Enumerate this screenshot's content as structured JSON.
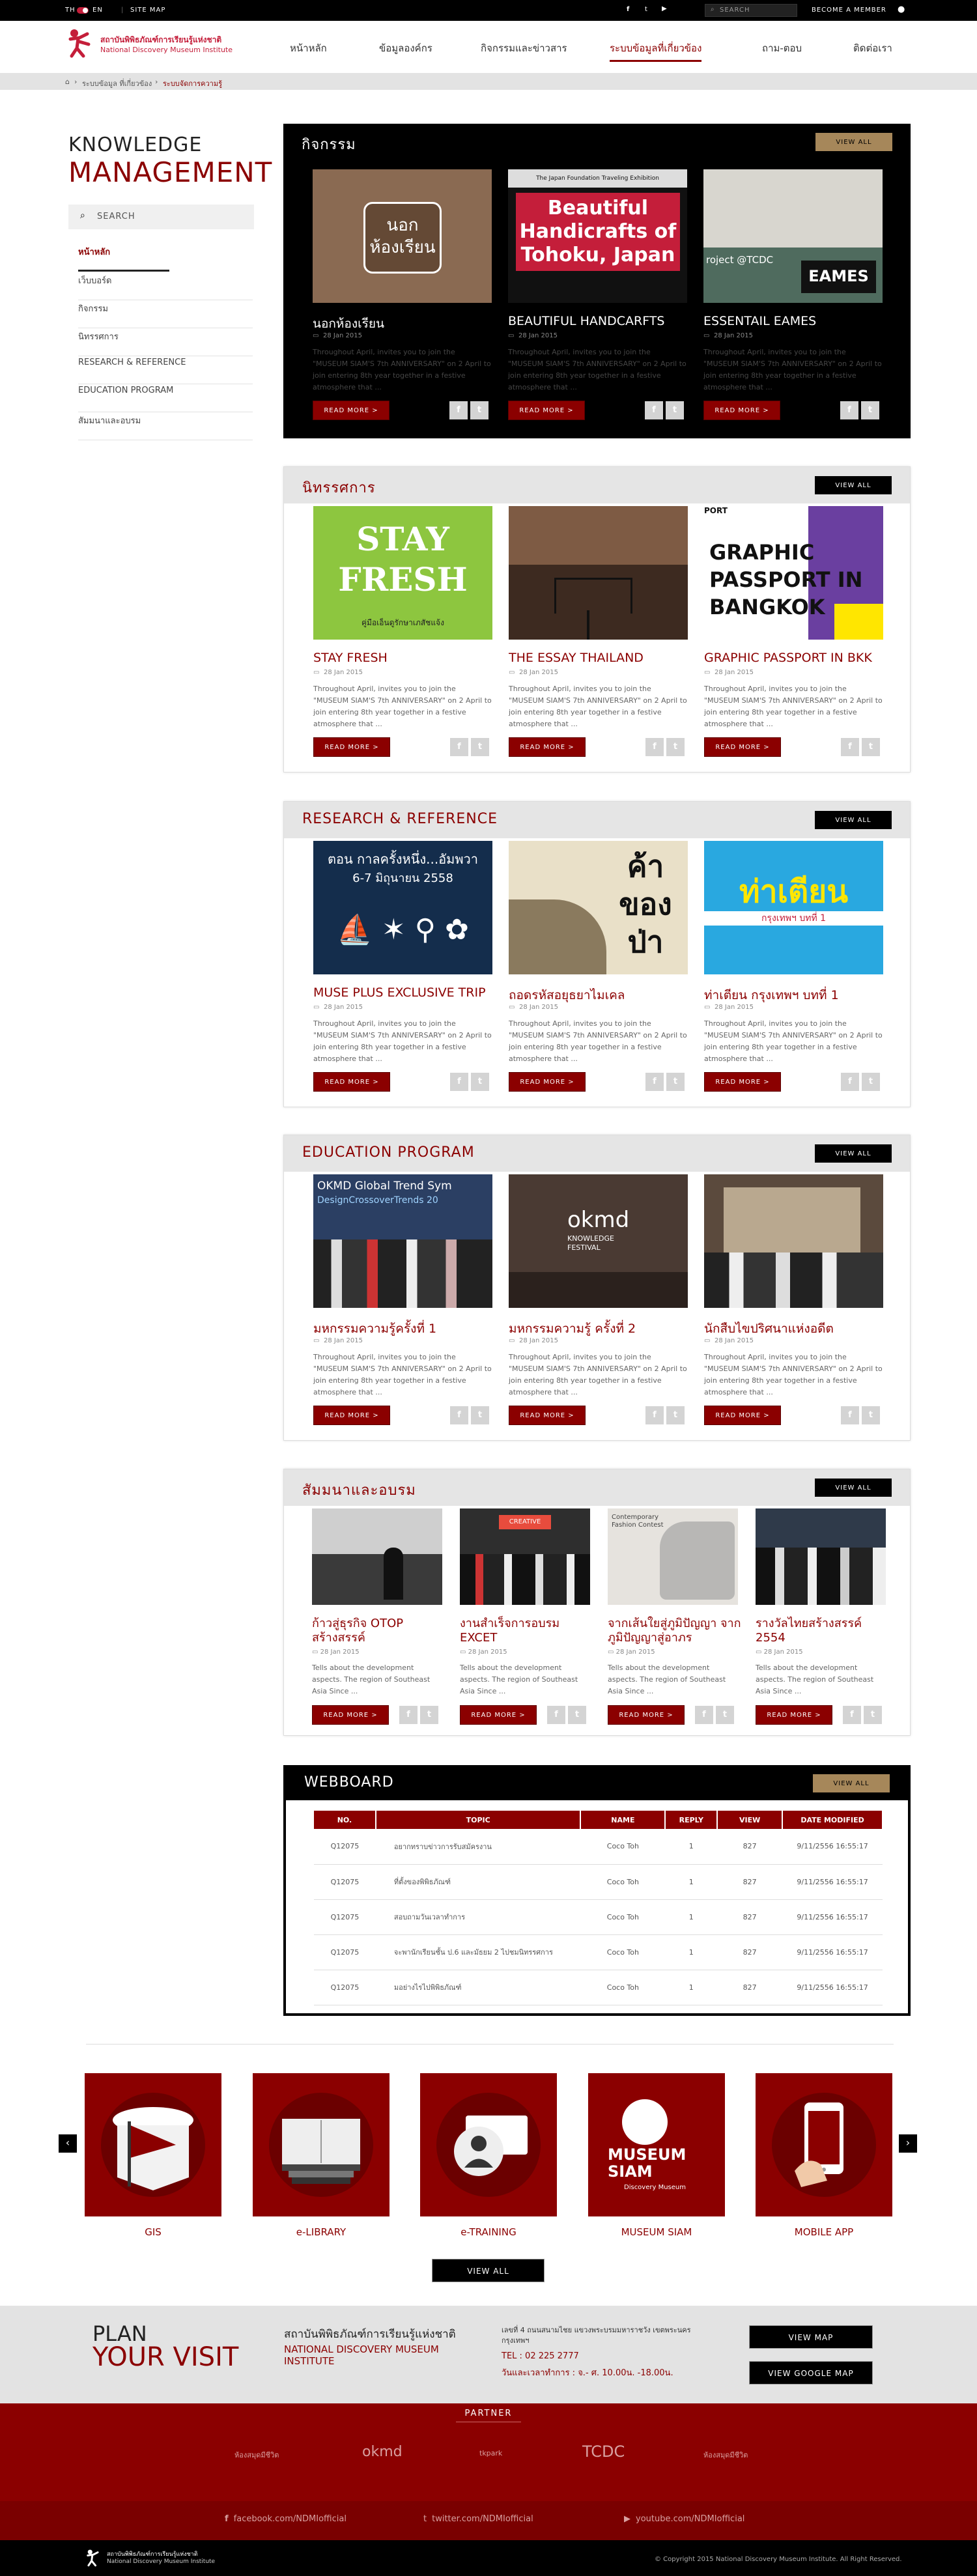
{
  "topbar": {
    "lang_th": "TH",
    "lang_en": "EN",
    "site_map": "SITE MAP",
    "search_placeholder": "SEARCH",
    "become_member": "BECOME A MEMBER"
  },
  "header": {
    "org_th": "สถาบันพิพิธภัณฑ์การเรียนรู้แห่งชาติ",
    "org_en": "National Discovery Museum Institute"
  },
  "nav": [
    {
      "label": "หน้าหลัก"
    },
    {
      "label": "ข้อมูลองค์กร"
    },
    {
      "label": "กิจกรรมและข่าวสาร"
    },
    {
      "label": "ระบบข้อมูลที่เกี่ยวข้อง",
      "active": true
    },
    {
      "label": "ถาม-ตอบ"
    },
    {
      "label": "ติดต่อเรา"
    }
  ],
  "breadcrumb": [
    "ระบบข้อมูล ที่เกี่ยวข้อง",
    "ระบบจัดการความรู้"
  ],
  "sidebar": {
    "title1": "KNOWLEDGE",
    "title2": "MANAGEMENT",
    "search": "SEARCH",
    "items": [
      "หน้าหลัก",
      "เว็บบอร์ด",
      "กิจกรรม",
      "นิทรรศการ",
      "RESEARCH & REFERENCE",
      "EDUCATION PROGRAM",
      "สัมมนาและอบรม"
    ]
  },
  "common": {
    "view_all": "VIEW ALL",
    "read_more": "READ MORE  >",
    "date": "28 Jan 2015",
    "fb": "f",
    "tw": "t"
  },
  "sections": [
    {
      "title": "กิจกรรม",
      "dark": true,
      "cards": [
        {
          "title": "นอกห้องเรียน",
          "img_text": "นอก ห้องเรียน",
          "desc": "Throughout April, invites you to join the \"MUSEUM SIAM'S 7th ANNIVERSARY\" on 2 April to join entering 8th year together in a festive atmosphere that ..."
        },
        {
          "title": "BEAUTIFUL HANDCARFTS",
          "img_text": "Beautiful Handicrafts of Tohoku, Japan",
          "img_sub": "The Japan Foundation Traveling Exhibition",
          "desc": "Throughout April, invites you to join the \"MUSEUM SIAM'S 7th ANNIVERSARY\" on 2 April to join entering 8th year together in a festive atmosphere that ..."
        },
        {
          "title": "ESSENTAIL EAMES",
          "img_text": "EAMES",
          "img_sub": "roject @TCDC",
          "desc": "Throughout April, invites you to join the \"MUSEUM SIAM'S 7th ANNIVERSARY\" on 2 April to join entering 8th year together in a festive atmosphere that ..."
        }
      ]
    },
    {
      "title": "นิทรรศการ",
      "dark": false,
      "cards": [
        {
          "title": "STAY FRESH",
          "img_text": "STAY FRESH",
          "img_sub": "คู่มือเอ็นดูรักษาเภสัชแจ้ง",
          "desc": "Throughout April, invites you to join the \"MUSEUM SIAM'S 7th ANNIVERSARY\" on 2 April to join entering 8th year together in a festive atmosphere that ..."
        },
        {
          "title": "THE ESSAY THAILAND",
          "img_text": "",
          "desc": "Throughout April, invites you to join the \"MUSEUM SIAM'S 7th ANNIVERSARY\" on 2 April to join entering 8th year together in a festive atmosphere that ..."
        },
        {
          "title": "GRAPHIC PASSPORT IN BKK",
          "img_text": "GRAPHIC PASSPORT IN BANGKOK",
          "img_sub": "PORT",
          "desc": "Throughout April, invites you to join the \"MUSEUM SIAM'S 7th ANNIVERSARY\" on 2 April to join entering 8th year together in a festive atmosphere that ..."
        }
      ]
    },
    {
      "title": "RESEARCH & REFERENCE",
      "dark": false,
      "cards": [
        {
          "title": "MUSE PLUS EXCLUSIVE TRIP",
          "img_text": "ตอน กาลครั้งหนึ่ง...อัมพวา",
          "img_sub": "6-7 มิถุนายน 2558",
          "desc": "Throughout April, invites you to join the \"MUSEUM SIAM'S 7th ANNIVERSARY\" on 2 April to join entering 8th year together in a festive atmosphere that ..."
        },
        {
          "title": "ถอดรหัสอยุธยาไมเคล",
          "img_text": "ค้า ของ ป่า",
          "desc": "Throughout April, invites you to join the \"MUSEUM SIAM'S 7th ANNIVERSARY\" on 2 April to join entering 8th year together in a festive atmosphere that ..."
        },
        {
          "title": "ท่าเตียน กรุงเทพฯ บทที่ 1",
          "img_text": "ท่าเตียน",
          "img_sub": "กรุงเทพฯ บทที่ 1",
          "desc": "Throughout April, invites you to join the \"MUSEUM SIAM'S 7th ANNIVERSARY\" on 2 April to join entering 8th year together in a festive atmosphere that ..."
        }
      ]
    },
    {
      "title": "EDUCATION PROGRAM",
      "dark": false,
      "cards": [
        {
          "title": "มหกรรมความรู้ครั้งที่ 1",
          "img_text": "OKMD Global Trend Sym",
          "img_sub": "DesignCrossoverTrends 20",
          "desc": "Throughout April, invites you to join the \"MUSEUM SIAM'S 7th ANNIVERSARY\" on 2 April to join entering 8th year together in a festive atmosphere that ..."
        },
        {
          "title": "มหกรรมความรู้ ครั้งที่ 2",
          "img_text": "okmd",
          "img_sub": "KNOWLEDGE FESTIVAL",
          "desc": "Throughout April, invites you to join the \"MUSEUM SIAM'S 7th ANNIVERSARY\" on 2 April to join entering 8th year together in a festive atmosphere that ..."
        },
        {
          "title": "นักสืบไขปริศนาแห่งอดีต",
          "img_text": "",
          "desc": "Throughout April, invites you to join the \"MUSEUM SIAM'S 7th ANNIVERSARY\" on 2 April to join entering 8th year together in a festive atmosphere that ..."
        }
      ]
    }
  ],
  "seminar": {
    "title": "สัมมนาและอบรม",
    "cards": [
      {
        "title": "ก้าวสู่ธุรกิจ OTOP สร้างสรรค์",
        "desc": "Tells about the development aspects. The region of Southeast Asia Since ..."
      },
      {
        "title": "งานสำเร็จการอบรม EXCET",
        "desc": "Tells about the development aspects. The region of Southeast Asia Since ..."
      },
      {
        "title": "จากเส้นใยสู่ภูมิปัญญา จากภูมิปัญญาสู่อาภร",
        "desc": "Tells about the development aspects. The region of Southeast Asia Since ..."
      },
      {
        "title": "รางวัลไทยสร้างสรรค์ 2554",
        "desc": "Tells about the development aspects. The region of Southeast Asia Since ..."
      }
    ],
    "img2_text": "CREATIVE",
    "img3_text": "Contemporary Fashion Contest"
  },
  "webboard": {
    "title": "WEBBOARD",
    "headers": [
      "NO.",
      "TOPIC",
      "NAME",
      "REPLY",
      "VIEW",
      "DATE MODIFIED"
    ],
    "rows": [
      [
        "Q12075",
        "อยากทราบข่าวการรับสมัครงาน",
        "Coco Toh",
        "1",
        "827",
        "9/11/2556 16:55:17"
      ],
      [
        "Q12075",
        "ที่ตั้งของพิพิธภัณฑ์",
        "Coco Toh",
        "1",
        "827",
        "9/11/2556 16:55:17"
      ],
      [
        "Q12075",
        "สอบถามวันเวลาทำการ",
        "Coco Toh",
        "1",
        "827",
        "9/11/2556 16:55:17"
      ],
      [
        "Q12075",
        "จะพานักเรียนชั้น ป.6 และมัธยม 2 ไปชมนิทรรศการ",
        "Coco Toh",
        "1",
        "827",
        "9/11/2556 16:55:17"
      ],
      [
        "Q12075",
        "มอย่างไรไปพิพิธภัณฑ์",
        "Coco Toh",
        "1",
        "827",
        "9/11/2556 16:55:17"
      ]
    ]
  },
  "services": [
    {
      "label": "GIS",
      "icon": "map-flag-icon"
    },
    {
      "label": "e-LIBRARY",
      "icon": "books-icon"
    },
    {
      "label": "e-TRAINING",
      "icon": "training-icon"
    },
    {
      "label": "MUSEUM SIAM",
      "icon": "museum-siam-logo",
      "logo_text": "MUSEUM SIAM",
      "logo_sub": "Discovery Museum"
    },
    {
      "label": "MOBILE APP",
      "icon": "mobile-app-icon"
    }
  ],
  "services_view_all": "VIEW ALL",
  "plan": {
    "plan": "PLAN",
    "your_visit": "YOUR VISIT",
    "org_th": "สถาบันพิพิธภัณฑ์การเรียนรู้แห่งชาติ",
    "org_en": "NATIONAL DISCOVERY MUSEUM INSTITUTE",
    "address": "เลขที่ 4 ถนนสนามไชย แขวงพระบรมมหาราชวัง เขตพระนคร กรุงเทพฯ",
    "tel": "TEL : 02 225 2777",
    "hours": "วันและเวลาทำการ : จ.- ศ. 10.00น. -18.00น.",
    "view_map": "VIEW MAP",
    "view_google_map": "VIEW GOOGLE MAP"
  },
  "partner": {
    "title": "PARTNER",
    "logos": [
      "ห้องสมุดมีชีวิต",
      "okmd",
      "tkpark",
      "TCDC",
      "ห้องสมุดมีชีวิต"
    ]
  },
  "social": {
    "facebook": "facebook.com/NDMIofficial",
    "twitter": "twitter.com/NDMIofficial",
    "youtube": "youtube.com/NDMIofficial"
  },
  "footer": {
    "org_th": "สถาบันพิพิธภัณฑ์การเรียนรู้แห่งชาติ",
    "org_en": "National Discovery Museum Institute",
    "copyright": "© Copyright 2015 National Discovery Museum Institute. All Right Reserved."
  },
  "colors": {
    "brand": "#8b0000",
    "gold": "#a6875a"
  }
}
